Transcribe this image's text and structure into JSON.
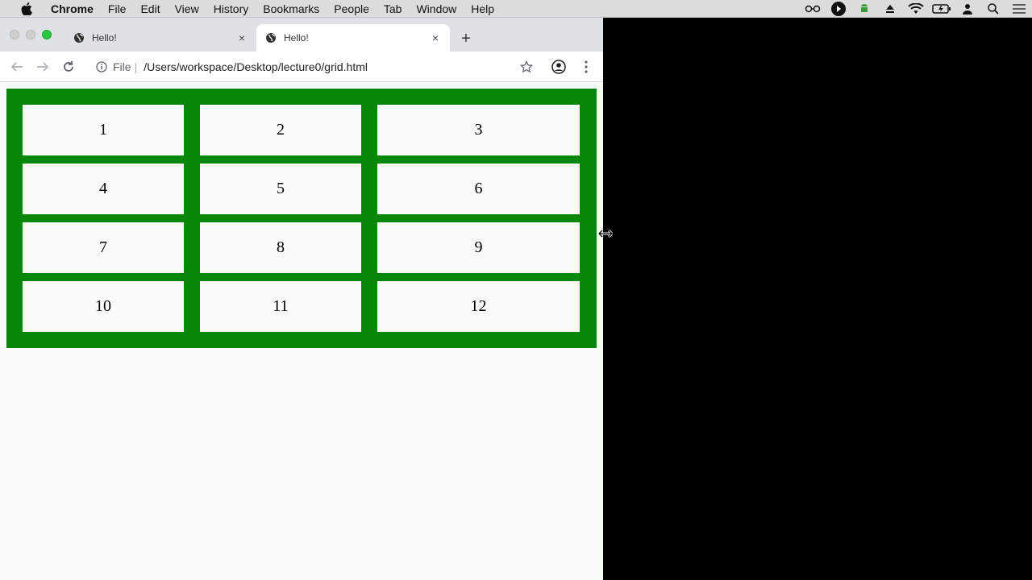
{
  "menubar": {
    "apple_icon": "apple-logo-icon",
    "items": [
      "Chrome",
      "File",
      "Edit",
      "View",
      "History",
      "Bookmarks",
      "People",
      "Tab",
      "Window",
      "Help"
    ],
    "status_icons": [
      "glasses-icon",
      "play-circle-icon",
      "android-icon",
      "eject-icon",
      "wifi-icon",
      "battery-icon",
      "user-icon",
      "search-icon",
      "list-icon"
    ]
  },
  "window": {
    "tabs": [
      {
        "title": "Hello!",
        "active": false,
        "favicon": "globe-icon"
      },
      {
        "title": "Hello!",
        "active": true,
        "favicon": "globe-icon"
      }
    ],
    "new_tab_label": "+",
    "close_label": "×",
    "toolbar": {
      "back_icon": "back-arrow-icon",
      "forward_icon": "forward-arrow-icon",
      "reload_icon": "reload-icon",
      "scheme": "File",
      "separator": "|",
      "url": "/Users/workspace/Desktop/lecture0/grid.html",
      "bookmark_icon": "star-icon",
      "profile_icon": "account-icon",
      "menu_icon": "kebab-menu-icon"
    }
  },
  "page": {
    "grid_color": "#068706",
    "items": [
      "1",
      "2",
      "3",
      "4",
      "5",
      "6",
      "7",
      "8",
      "9",
      "10",
      "11",
      "12"
    ]
  }
}
